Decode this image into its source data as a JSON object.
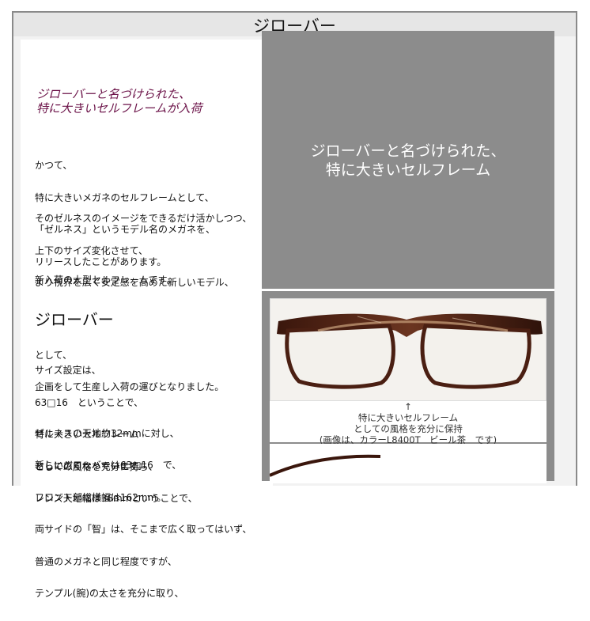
{
  "page": {
    "title": "ジローバー"
  },
  "left": {
    "headline_line1": "ジローバーと名づけられた、",
    "headline_line2": "特に大きいセルフレームが入荷",
    "para1": [
      "かつて、",
      "特に大きいメガネのセルフレームとして、",
      "「ゼルネス」というモデル名のメガネを、",
      "リリースしたことがあります。"
    ],
    "para2": [
      "そのゼルネスのイメージをできるだけ活かしつつ、",
      "上下のサイズ変化させて、",
      "より視界を広く安定感を高めた新しいモデル、"
    ],
    "big_name": "ジローバー",
    "para3": [
      "として、",
      "企画をして生産し入荷の運びとなりました。"
    ],
    "para4": "新入荷の大型セルフレームです。",
    "para5": [
      "サイズ設定は、",
      "63□16　ということで、",
      "特に大きいセルフレーム",
      "としての風格を充分に持ち、",
      "レンズ天地幅は36mmということで、"
    ],
    "para6": [
      "ゼルネスの天地約32mmに対し、",
      "さらに広くなっています。"
    ],
    "para7": [
      "新しいジローバーは63□16　で、",
      "フロント部総横幅は162mm。",
      "両サイドの「智」は、そこまで広く取ってはいず、",
      "普通のメガネと同じ程度ですが、",
      "テンプル(腕)の太さを充分に取り、"
    ]
  },
  "right": {
    "heading_line1": "ジローバーと名づけられた、",
    "heading_line2": "特に大きいセルフレーム",
    "arrow": "↑",
    "caption_line1": "特に大きいセルフレーム",
    "caption_line2": "としての風格を充分に保持",
    "caption_line3": "(画像は、カラーL8400T　ビール茶　です)"
  },
  "colors": {
    "headline": "#6b1248",
    "panel_gray": "#8c8c8c",
    "frame_brown": "#4a1f12"
  }
}
